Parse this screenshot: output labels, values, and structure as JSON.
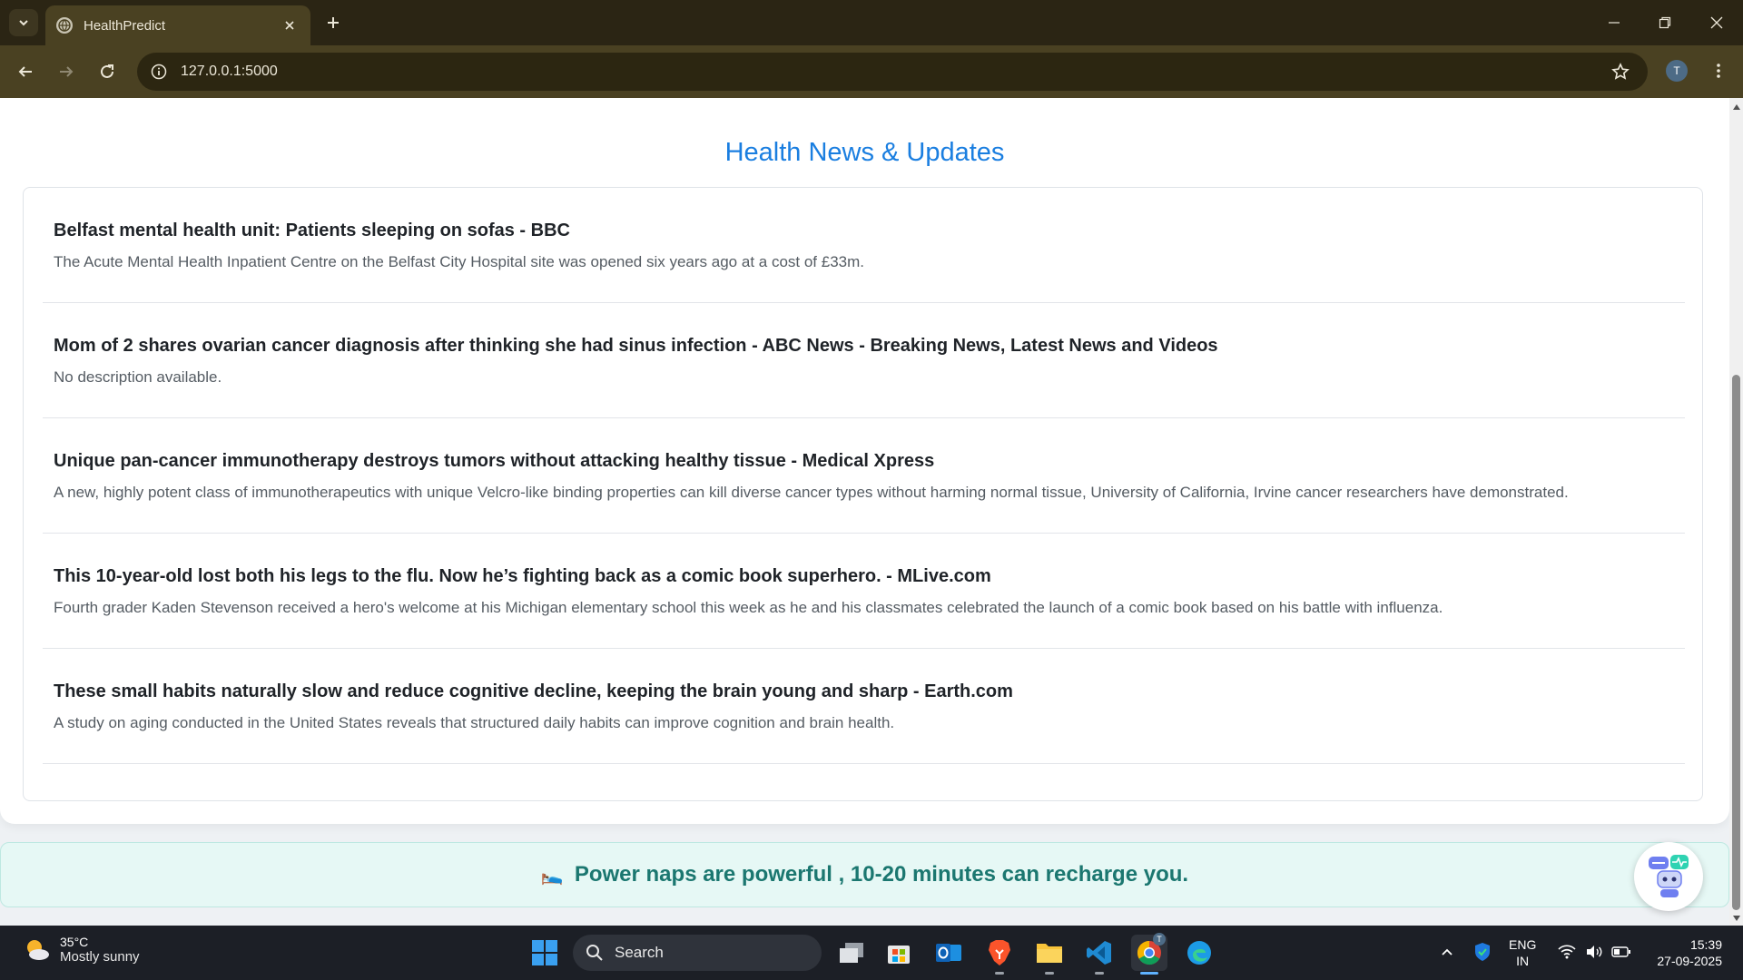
{
  "browser": {
    "tab_title": "HealthPredict",
    "url": "127.0.0.1:5000",
    "profile_initial": "T"
  },
  "news": {
    "heading": "Health News & Updates",
    "items": [
      {
        "title": "Belfast mental health unit: Patients sleeping on sofas - BBC",
        "description": "The Acute Mental Health Inpatient Centre on the Belfast City Hospital site was opened six years ago at a cost of £33m."
      },
      {
        "title": "Mom of 2 shares ovarian cancer diagnosis after thinking she had sinus infection - ABC News - Breaking News, Latest News and Videos",
        "description": "No description available."
      },
      {
        "title": "Unique pan-cancer immunotherapy destroys tumors without attacking healthy tissue - Medical Xpress",
        "description": "A new, highly potent class of immunotherapeutics with unique Velcro-like binding properties can kill diverse cancer types without harming normal tissue, University of California, Irvine cancer researchers have demonstrated."
      },
      {
        "title": "This 10-year-old lost both his legs to the flu. Now he’s fighting back as a comic book superhero. - MLive.com",
        "description": "Fourth grader Kaden Stevenson received a hero's welcome at his Michigan elementary school this week as he and his classmates celebrated the launch of a comic book based on his battle with influenza."
      },
      {
        "title": "These small habits naturally slow and reduce cognitive decline, keeping the brain young and sharp - Earth.com",
        "description": "A study on aging conducted in the United States reveals that structured daily habits can improve cognition and brain health."
      }
    ]
  },
  "tip": {
    "emoji": "🛌",
    "text": "Power naps are powerful , 10-20 minutes can recharge you."
  },
  "taskbar": {
    "weather_temp": "35°C",
    "weather_condition": "Mostly sunny",
    "search_label": "Search",
    "lang_primary": "ENG",
    "lang_region": "IN",
    "time": "15:39",
    "date": "27-09-2025",
    "chrome_badge": "T"
  },
  "colors": {
    "accent": "#1a7ee0",
    "tip_text": "#1b7770",
    "tip_bg": "#e6f8f5",
    "chrome_frame": "#2b2514",
    "chrome_toolbar": "#4a4122"
  }
}
